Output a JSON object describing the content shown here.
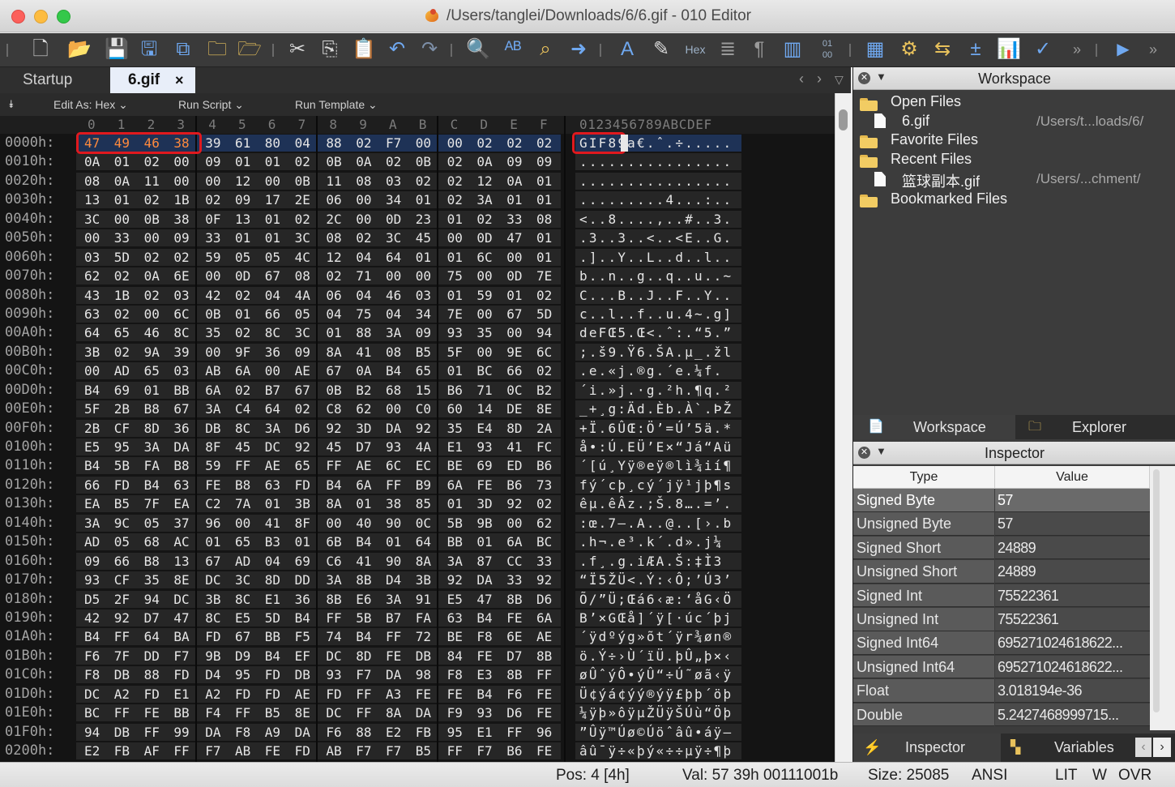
{
  "window": {
    "title": "/Users/tanglei/Downloads/6/6.gif - 010 Editor"
  },
  "toolbar": {
    "hex_label": "Hex"
  },
  "tabs": [
    {
      "label": "Startup"
    },
    {
      "label": "6.gif",
      "close": "×"
    }
  ],
  "edit_bar": {
    "edit_as": "Edit As: Hex",
    "run_script": "Run Script",
    "run_template": "Run Template"
  },
  "hex": {
    "columns": [
      "0",
      "1",
      "2",
      "3",
      "4",
      "5",
      "6",
      "7",
      "8",
      "9",
      "A",
      "B",
      "C",
      "D",
      "E",
      "F"
    ],
    "ascii_header": "0123456789ABCDEF",
    "rows": [
      {
        "addr": "0000h:",
        "bytes": [
          "47",
          "49",
          "46",
          "38",
          "39",
          "61",
          "80",
          "04",
          "88",
          "02",
          "F7",
          "00",
          "00",
          "02",
          "02",
          "02"
        ],
        "ascii": "GIF89a€.ˆ.÷....."
      },
      {
        "addr": "0010h:",
        "bytes": [
          "0A",
          "01",
          "02",
          "00",
          "09",
          "01",
          "01",
          "02",
          "0B",
          "0A",
          "02",
          "0B",
          "02",
          "0A",
          "09",
          "09"
        ],
        "ascii": "................"
      },
      {
        "addr": "0020h:",
        "bytes": [
          "08",
          "0A",
          "11",
          "00",
          "00",
          "12",
          "00",
          "0B",
          "11",
          "08",
          "03",
          "02",
          "02",
          "12",
          "0A",
          "01"
        ],
        "ascii": "................"
      },
      {
        "addr": "0030h:",
        "bytes": [
          "13",
          "01",
          "02",
          "1B",
          "02",
          "09",
          "17",
          "2E",
          "06",
          "00",
          "34",
          "01",
          "02",
          "3A",
          "01",
          "01"
        ],
        "ascii": ".........4...:.."
      },
      {
        "addr": "0040h:",
        "bytes": [
          "3C",
          "00",
          "0B",
          "38",
          "0F",
          "13",
          "01",
          "02",
          "2C",
          "00",
          "0D",
          "23",
          "01",
          "02",
          "33",
          "08"
        ],
        "ascii": "<..8....,..#..3."
      },
      {
        "addr": "0050h:",
        "bytes": [
          "00",
          "33",
          "00",
          "09",
          "33",
          "01",
          "01",
          "3C",
          "08",
          "02",
          "3C",
          "45",
          "00",
          "0D",
          "47",
          "01"
        ],
        "ascii": ".3..3..<..<E..G."
      },
      {
        "addr": "0060h:",
        "bytes": [
          "03",
          "5D",
          "02",
          "02",
          "59",
          "05",
          "05",
          "4C",
          "12",
          "04",
          "64",
          "01",
          "01",
          "6C",
          "00",
          "01"
        ],
        "ascii": ".]..Y..L..d..l.."
      },
      {
        "addr": "0070h:",
        "bytes": [
          "62",
          "02",
          "0A",
          "6E",
          "00",
          "0D",
          "67",
          "08",
          "02",
          "71",
          "00",
          "00",
          "75",
          "00",
          "0D",
          "7E"
        ],
        "ascii": "b..n..g..q..u..~"
      },
      {
        "addr": "0080h:",
        "bytes": [
          "43",
          "1B",
          "02",
          "03",
          "42",
          "02",
          "04",
          "4A",
          "06",
          "04",
          "46",
          "03",
          "01",
          "59",
          "01",
          "02"
        ],
        "ascii": "C...B..J..F..Y.."
      },
      {
        "addr": "0090h:",
        "bytes": [
          "63",
          "02",
          "00",
          "6C",
          "0B",
          "01",
          "66",
          "05",
          "04",
          "75",
          "04",
          "34",
          "7E",
          "00",
          "67",
          "5D"
        ],
        "ascii": "c..l..f..u.4~.g]"
      },
      {
        "addr": "00A0h:",
        "bytes": [
          "64",
          "65",
          "46",
          "8C",
          "35",
          "02",
          "8C",
          "3C",
          "01",
          "88",
          "3A",
          "09",
          "93",
          "35",
          "00",
          "94"
        ],
        "ascii": "deFŒ5.Œ<.ˆ:.“5.”"
      },
      {
        "addr": "00B0h:",
        "bytes": [
          "3B",
          "02",
          "9A",
          "39",
          "00",
          "9F",
          "36",
          "09",
          "8A",
          "41",
          "08",
          "B5",
          "5F",
          "00",
          "9E",
          "6C"
        ],
        "ascii": ";.š9.Ÿ6.ŠA.µ_.žl"
      },
      {
        "addr": "00C0h:",
        "bytes": [
          "00",
          "AD",
          "65",
          "03",
          "AB",
          "6A",
          "00",
          "AE",
          "67",
          "0A",
          "B4",
          "65",
          "01",
          "BC",
          "66",
          "02"
        ],
        "ascii": ".­e.«j.®g.´e.¼f."
      },
      {
        "addr": "00D0h:",
        "bytes": [
          "B4",
          "69",
          "01",
          "BB",
          "6A",
          "02",
          "B7",
          "67",
          "0B",
          "B2",
          "68",
          "15",
          "B6",
          "71",
          "0C",
          "B2"
        ],
        "ascii": "´i.»j.·g.²h.¶q.²"
      },
      {
        "addr": "00E0h:",
        "bytes": [
          "5F",
          "2B",
          "B8",
          "67",
          "3A",
          "C4",
          "64",
          "02",
          "C8",
          "62",
          "00",
          "C0",
          "60",
          "14",
          "DE",
          "8E"
        ],
        "ascii": "_+¸g:Äd.Èb.À`.ÞŽ"
      },
      {
        "addr": "00F0h:",
        "bytes": [
          "2B",
          "CF",
          "8D",
          "36",
          "DB",
          "8C",
          "3A",
          "D6",
          "92",
          "3D",
          "DA",
          "92",
          "35",
          "E4",
          "8D",
          "2A"
        ],
        "ascii": "+Ï.6ÛŒ:Ö’=Ú’5ä.*"
      },
      {
        "addr": "0100h:",
        "bytes": [
          "E5",
          "95",
          "3A",
          "DA",
          "8F",
          "45",
          "DC",
          "92",
          "45",
          "D7",
          "93",
          "4A",
          "E1",
          "93",
          "41",
          "FC"
        ],
        "ascii": "å•:Ú.EÜ’E×“Já“Aü"
      },
      {
        "addr": "0110h:",
        "bytes": [
          "B4",
          "5B",
          "FA",
          "B8",
          "59",
          "FF",
          "AE",
          "65",
          "FF",
          "AE",
          "6C",
          "EC",
          "BE",
          "69",
          "ED",
          "B6"
        ],
        "ascii": "´[ú¸Yÿ®eÿ®lì¾ií¶"
      },
      {
        "addr": "0120h:",
        "bytes": [
          "66",
          "FD",
          "B4",
          "63",
          "FE",
          "B8",
          "63",
          "FD",
          "B4",
          "6A",
          "FF",
          "B9",
          "6A",
          "FE",
          "B6",
          "73"
        ],
        "ascii": "fý´cþ¸cý´jÿ¹jþ¶s"
      },
      {
        "addr": "0130h:",
        "bytes": [
          "EA",
          "B5",
          "7F",
          "EA",
          "C2",
          "7A",
          "01",
          "3B",
          "8A",
          "01",
          "38",
          "85",
          "01",
          "3D",
          "92",
          "02"
        ],
        "ascii": "êµ.êÂz.;Š.8….=’."
      },
      {
        "addr": "0140h:",
        "bytes": [
          "3A",
          "9C",
          "05",
          "37",
          "96",
          "00",
          "41",
          "8F",
          "00",
          "40",
          "90",
          "0C",
          "5B",
          "9B",
          "00",
          "62"
        ],
        "ascii": ":œ.7–.A..@..[›.b"
      },
      {
        "addr": "0150h:",
        "bytes": [
          "AD",
          "05",
          "68",
          "AC",
          "01",
          "65",
          "B3",
          "01",
          "6B",
          "B4",
          "01",
          "64",
          "BB",
          "01",
          "6A",
          "BC"
        ],
        "ascii": "­.h¬.e³.k´.d».j¼"
      },
      {
        "addr": "0160h:",
        "bytes": [
          "09",
          "66",
          "B8",
          "13",
          "67",
          "AD",
          "04",
          "69",
          "C6",
          "41",
          "90",
          "8A",
          "3A",
          "87",
          "CC",
          "33"
        ],
        "ascii": ".f¸.g­.iÆA.Š:‡Ì3"
      },
      {
        "addr": "0170h:",
        "bytes": [
          "93",
          "CF",
          "35",
          "8E",
          "DC",
          "3C",
          "8D",
          "DD",
          "3A",
          "8B",
          "D4",
          "3B",
          "92",
          "DA",
          "33",
          "92"
        ],
        "ascii": "“Ï5ŽÜ<.Ý:‹Ô;’Ú3’"
      },
      {
        "addr": "0180h:",
        "bytes": [
          "D5",
          "2F",
          "94",
          "DC",
          "3B",
          "8C",
          "E1",
          "36",
          "8B",
          "E6",
          "3A",
          "91",
          "E5",
          "47",
          "8B",
          "D6"
        ],
        "ascii": "Õ/”Ü;Œá6‹æ:‘åG‹Ö"
      },
      {
        "addr": "0190h:",
        "bytes": [
          "42",
          "92",
          "D7",
          "47",
          "8C",
          "E5",
          "5D",
          "B4",
          "FF",
          "5B",
          "B7",
          "FA",
          "63",
          "B4",
          "FE",
          "6A"
        ],
        "ascii": "B’×GŒå]´ÿ[·úc´þj"
      },
      {
        "addr": "01A0h:",
        "bytes": [
          "B4",
          "FF",
          "64",
          "BA",
          "FD",
          "67",
          "BB",
          "F5",
          "74",
          "B4",
          "FF",
          "72",
          "BE",
          "F8",
          "6E",
          "AE"
        ],
        "ascii": "´ÿdºýg»õt´ÿr¾øn®"
      },
      {
        "addr": "01B0h:",
        "bytes": [
          "F6",
          "7F",
          "DD",
          "F7",
          "9B",
          "D9",
          "B4",
          "EF",
          "DC",
          "8D",
          "FE",
          "DB",
          "84",
          "FE",
          "D7",
          "8B"
        ],
        "ascii": "ö.Ý÷›Ù´ïÜ.þÛ„þ×‹"
      },
      {
        "addr": "01C0h:",
        "bytes": [
          "F8",
          "DB",
          "88",
          "FD",
          "D4",
          "95",
          "FD",
          "DB",
          "93",
          "F7",
          "DA",
          "98",
          "F8",
          "E3",
          "8B",
          "FF"
        ],
        "ascii": "øÛˆýÔ•ýÛ“÷Ú˜øã‹ÿ"
      },
      {
        "addr": "01D0h:",
        "bytes": [
          "DC",
          "A2",
          "FD",
          "E1",
          "A2",
          "FD",
          "FD",
          "AE",
          "FD",
          "FF",
          "A3",
          "FE",
          "FE",
          "B4",
          "F6",
          "FE"
        ],
        "ascii": "Ü¢ýá¢ýý®ýÿ£þþ´öþ"
      },
      {
        "addr": "01E0h:",
        "bytes": [
          "BC",
          "FF",
          "FE",
          "BB",
          "F4",
          "FF",
          "B5",
          "8E",
          "DC",
          "FF",
          "8A",
          "DA",
          "F9",
          "93",
          "D6",
          "FE"
        ],
        "ascii": "¼ÿþ»ôÿµŽÜÿŠÚù“Öþ"
      },
      {
        "addr": "01F0h:",
        "bytes": [
          "94",
          "DB",
          "FF",
          "99",
          "DA",
          "F8",
          "A9",
          "DA",
          "F6",
          "88",
          "E2",
          "FB",
          "95",
          "E1",
          "FF",
          "96"
        ],
        "ascii": "”Ûÿ™Úø©Úöˆâû•áÿ–"
      },
      {
        "addr": "0200h:",
        "bytes": [
          "E2",
          "FB",
          "AF",
          "FF",
          "F7",
          "AB",
          "FE",
          "FD",
          "AB",
          "F7",
          "F7",
          "B5",
          "FF",
          "F7",
          "B6",
          "FE"
        ],
        "ascii": "âû¯ÿ÷«þý«÷÷µÿ÷¶þ"
      }
    ]
  },
  "workspace": {
    "title": "Workspace",
    "open_files": "Open Files",
    "open_file": {
      "name": "6.gif",
      "path": "/Users/t...loads/6/"
    },
    "favorite_files": "Favorite Files",
    "recent_files": "Recent Files",
    "recent_file": {
      "name": "篮球副本.gif",
      "path": "/Users/...chment/"
    },
    "bookmarked_files": "Bookmarked Files"
  },
  "panel_tabs": {
    "workspace": "Workspace",
    "explorer": "Explorer"
  },
  "inspector": {
    "title": "Inspector",
    "col_type": "Type",
    "col_value": "Value",
    "rows": [
      {
        "type": "Signed Byte",
        "value": "57"
      },
      {
        "type": "Unsigned Byte",
        "value": "57"
      },
      {
        "type": "Signed Short",
        "value": "24889"
      },
      {
        "type": "Unsigned Short",
        "value": "24889"
      },
      {
        "type": "Signed Int",
        "value": "75522361"
      },
      {
        "type": "Unsigned Int",
        "value": "75522361"
      },
      {
        "type": "Signed Int64",
        "value": "695271024618622..."
      },
      {
        "type": "Unsigned Int64",
        "value": "695271024618622..."
      },
      {
        "type": "Float",
        "value": "3.018194e-36"
      },
      {
        "type": "Double",
        "value": "5.2427468999715..."
      }
    ]
  },
  "bottom_tabs": {
    "inspector": "Inspector",
    "variables": "Variables"
  },
  "status": {
    "pos": "Pos: 4 [4h]",
    "val": "Val: 57 39h 00111001b",
    "size": "Size: 25085",
    "encoding": "ANSI",
    "lit": "LIT",
    "w": "W",
    "ovr": "OVR"
  },
  "colors": {
    "highlight": "#e0191e",
    "selection": "#1e3256"
  }
}
